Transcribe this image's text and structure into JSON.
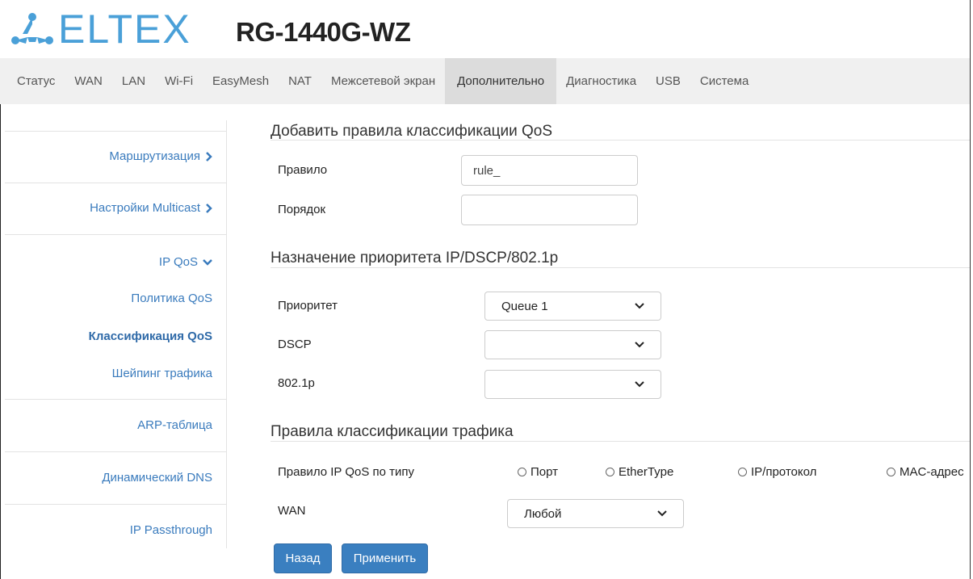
{
  "header": {
    "logo_text": "ELTEX",
    "model": "RG-1440G-WZ",
    "brand_color": "#4aa0d8"
  },
  "nav": {
    "items": [
      "Статус",
      "WAN",
      "LAN",
      "Wi-Fi",
      "EasyMesh",
      "NAT",
      "Межсетевой экран",
      "Дополнительно",
      "Диагностика",
      "USB",
      "Система"
    ],
    "active": "Дополнительно"
  },
  "sidebar": {
    "routing": "Маршрутизация",
    "multicast": "Настройки Multicast",
    "ipqos": "IP QoS",
    "qos_policy": "Политика QoS",
    "qos_classification": "Классификация QoS",
    "traffic_shaping": "Шейпинг трафика",
    "arp_table": "ARP-таблица",
    "ddns": "Динамический DNS",
    "ip_passthrough": "IP Passthrough"
  },
  "form": {
    "section1_title": "Добавить правила классификации QoS",
    "rule_label": "Правило",
    "rule_value": "rule_",
    "order_label": "Порядок",
    "order_value": "",
    "section2_title": "Назначение приоритета IP/DSCP/802.1p",
    "priority_label": "Приоритет",
    "priority_value": "Queue 1",
    "dscp_label": "DSCP",
    "dscp_value": "",
    "p8021_label": "802.1p",
    "p8021_value": "",
    "section3_title": "Правила классификации трафика",
    "qos_type_label": "Правило IP QoS по типу",
    "radio_port": "Порт",
    "radio_ethertype": "EtherType",
    "radio_ipproto": "IP/протокол",
    "radio_mac": "MAC-адрес",
    "wan_label": "WAN",
    "wan_value": "Любой"
  },
  "buttons": {
    "back": "Назад",
    "apply": "Применить",
    "accent": "#3a7fc0"
  }
}
